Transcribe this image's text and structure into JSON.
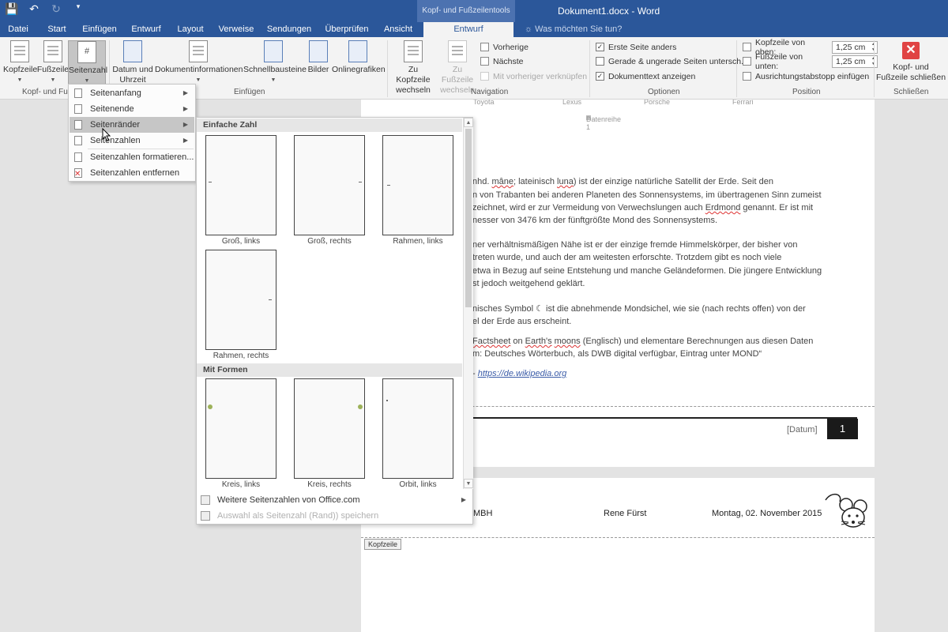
{
  "title_bar": {
    "context_label": "Kopf- und Fußzeilentools",
    "document_title": "Dokument1.docx - Word",
    "qat_icons": [
      "save-icon",
      "undo-icon",
      "redo-icon",
      "customize-icon"
    ]
  },
  "tabs": [
    "Datei",
    "Start",
    "Einfügen",
    "Entwurf",
    "Layout",
    "Verweise",
    "Sendungen",
    "Überprüfen",
    "Ansicht",
    "Entwurf"
  ],
  "tell_me": "Was möchten Sie tun?",
  "ribbon": {
    "kopfzeile": "Kopfzeile",
    "fusszeile": "Fußzeile",
    "seitenzahl": "Seitenzahl",
    "group1_label": "Kopf- und Fu",
    "datum_line1": "Datum und",
    "datum_line2": "Uhrzeit",
    "dokinfo": "Dokumentinformationen",
    "schnellbausteine": "Schnellbausteine",
    "bilder": "Bilder",
    "onlinegrafiken": "Onlinegrafiken",
    "group2_label": "Einfügen",
    "zu_kopf_line1": "Zu Kopfzeile",
    "zu_kopf_line2": "wechseln",
    "zu_fuss_line1": "Zu Fußzeile",
    "zu_fuss_line2": "wechseln",
    "vorherige": "Vorherige",
    "naechste": "Nächste",
    "verknuepfen": "Mit vorheriger verknüpfen",
    "group3_label": "Navigation",
    "opt1": "Erste Seite anders",
    "opt2": "Gerade & ungerade Seiten untersch.",
    "opt3": "Dokumenttext anzeigen",
    "group4_label": "Optionen",
    "kopf_oben_label": "Kopfzeile von oben:",
    "kopf_oben_value": "1,25 cm",
    "fuss_unten_label": "Fußzeile von unten:",
    "fuss_unten_value": "1,25 cm",
    "tabstopp": "Ausrichtungstabstopp einfügen",
    "group5_label": "Position",
    "close_line1": "Kopf- und",
    "close_line2": "Fußzeile schließen",
    "group6_label": "Schließen"
  },
  "menu": {
    "items": [
      "Seitenanfang",
      "Seitenende",
      "Seitenränder",
      "Seitenzahlen",
      "Seitenzahlen formatieren...",
      "Seitenzahlen entfernen"
    ]
  },
  "gallery": {
    "section1": "Einfache Zahl",
    "section2": "Mit Formen",
    "thumbs": [
      "Groß, links",
      "Groß, rechts",
      "Rahmen, links",
      "Rahmen, rechts",
      "Kreis, links",
      "Kreis, rechts",
      "Orbit, links"
    ],
    "more": "Weitere Seitenzahlen von Office.com",
    "save_selection": "Auswahl als Seitenzahl (Rand)) speichern"
  },
  "document": {
    "chart_labels": [
      "Toyota",
      "Lexus",
      "Porsche",
      "Ferrari"
    ],
    "chart_legend": "Datenreihe 1",
    "lines": [
      [
        "nhd. ",
        "mâne",
        "; lateinisch ",
        "luna",
        ") ist der einzige natürliche Satellit der Erde. Seit den"
      ],
      [
        "n von Trabanten bei anderen Planeten des Sonnensystems, im übertragenen Sinn zumeist"
      ],
      [
        "zeichnet, wird er zur Vermeidung von Verwechslungen auch ",
        "Erdmond",
        " genannt. Er ist mit"
      ],
      [
        "nesser von 3476 km der fünftgrößte Mond des Sonnensystems."
      ],
      [
        "ner verhältnismäßigen Nähe ist er der einzige fremde Himmelskörper, der bisher von"
      ],
      [
        "treten wurde, und auch der am weitesten erforschte. Trotzdem gibt es noch viele"
      ],
      [
        " etwa in Bezug auf seine Entstehung und manche Geländeformen. Die jüngere Entwicklung"
      ],
      [
        "st jedoch weitgehend geklärt."
      ],
      [
        "nisches Symbol ☾ ist die abnehmende Mondsichel, wie sie (nach rechts offen) von der"
      ],
      [
        "el der Erde aus erscheint."
      ],
      [
        " ",
        "Factsheet",
        " on ",
        "Earth's",
        " ",
        "moons",
        " (Englisch) und elementare Berechnungen aus diesen Daten"
      ],
      [
        "m: Deutsches Wörterbuch, als DWB digital verfügbar, Eintrag unter MOND“"
      ],
      [
        " - "
      ]
    ],
    "link": "https://de.wikipedia.org",
    "footer_date": "[Datum]",
    "page_number": "1",
    "header_company": "MBH",
    "header_author": "Rene Fürst",
    "header_date": "Montag, 02. November 2015",
    "header_tag": "Kopfzeile",
    "logo_icon": "mouse-icon"
  },
  "colors": {
    "accent": "#2b579a",
    "close_red": "#e04343",
    "shape_dot": "#9db25a"
  }
}
